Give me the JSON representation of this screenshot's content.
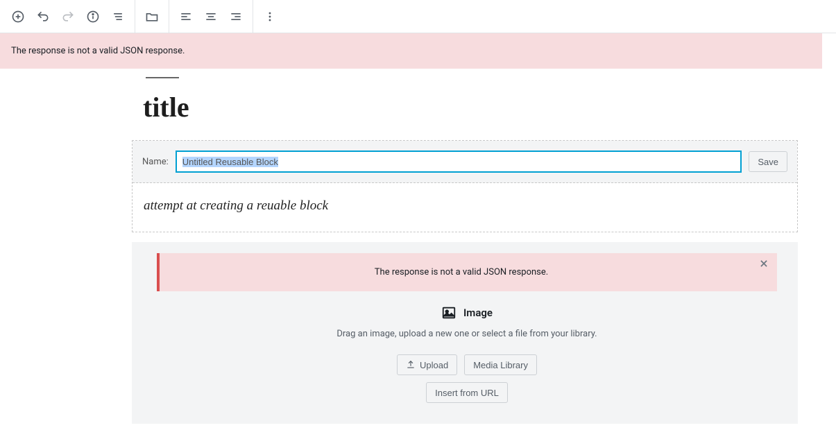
{
  "toolbar": {
    "add": "Add block",
    "undo": "Undo",
    "redo": "Redo",
    "info": "Content structure",
    "outline": "Block navigation",
    "transform": "Change block type",
    "align_left": "Align left",
    "align_center": "Align center",
    "align_right": "Align right",
    "more": "More options"
  },
  "global_error": "The response is not a valid JSON response.",
  "post": {
    "title": "title"
  },
  "reusable": {
    "name_label": "Name:",
    "name_value": "Untitled Reusable Block",
    "save_label": "Save",
    "paragraph": "attempt at creating a reuable block"
  },
  "image_block": {
    "error_message": "The response is not a valid JSON response.",
    "label": "Image",
    "instructions": "Drag an image, upload a new one or select a file from your library.",
    "upload_label": "Upload",
    "media_library_label": "Media Library",
    "insert_url_label": "Insert from URL"
  }
}
